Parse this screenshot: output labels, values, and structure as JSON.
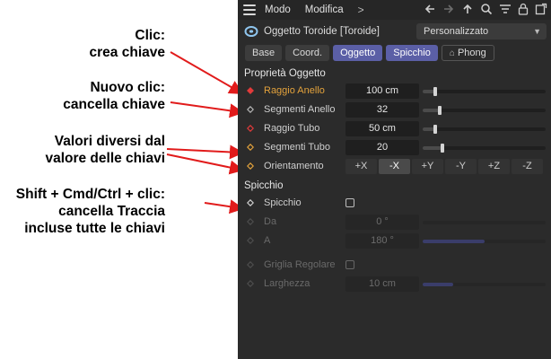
{
  "annotations": [
    {
      "lines": [
        "Clic:",
        "crea chiave"
      ]
    },
    {
      "lines": [
        "Nuovo clic:",
        "cancella chiave"
      ]
    },
    {
      "lines": [
        "Valori diversi dal",
        "valore delle chiavi"
      ]
    },
    {
      "lines": [
        "Shift + Cmd/Ctrl + clic:",
        "cancella Traccia",
        "incluse tutte le chiavi"
      ]
    }
  ],
  "menubar": {
    "items": [
      "Modo",
      "Modifica"
    ],
    "more": ">"
  },
  "object": {
    "name": "Oggetto Toroide [Toroide]",
    "preset": "Personalizzato"
  },
  "tabs": [
    "Base",
    "Coord.",
    "Oggetto",
    "Spicchio",
    "Phong"
  ],
  "sections": {
    "object_props": "Proprietà Oggetto",
    "slice": "Spicchio"
  },
  "params": {
    "raggio_anello": {
      "label": "Raggio Anello",
      "value": "100 cm",
      "slider": 0.1
    },
    "segmenti_anello": {
      "label": "Segmenti Anello",
      "value": "32",
      "slider": 0.14
    },
    "raggio_tubo": {
      "label": "Raggio Tubo",
      "value": "50 cm",
      "slider": 0.1
    },
    "segmenti_tubo": {
      "label": "Segmenti Tubo",
      "value": "20",
      "slider": 0.16
    },
    "orientamento": {
      "label": "Orientamento",
      "options": [
        "+X",
        "-X",
        "+Y",
        "-Y",
        "+Z",
        "-Z"
      ],
      "selected": "-X"
    },
    "spicchio": {
      "label": "Spicchio"
    },
    "da": {
      "label": "Da",
      "value": "0 °",
      "slider": 0.0
    },
    "a": {
      "label": "A",
      "value": "180 °",
      "slider": 0.5
    },
    "griglia": {
      "label": "Griglia Regolare"
    },
    "larghezza": {
      "label": "Larghezza",
      "value": "10 cm",
      "slider": 0.25
    }
  },
  "colors": {
    "panel_bg": "#2b2b2b",
    "accent_tab": "#5b5fa6",
    "key_active": "#e23a3a",
    "key_diff": "#e3a23c",
    "arrow": "#e11b1b"
  }
}
